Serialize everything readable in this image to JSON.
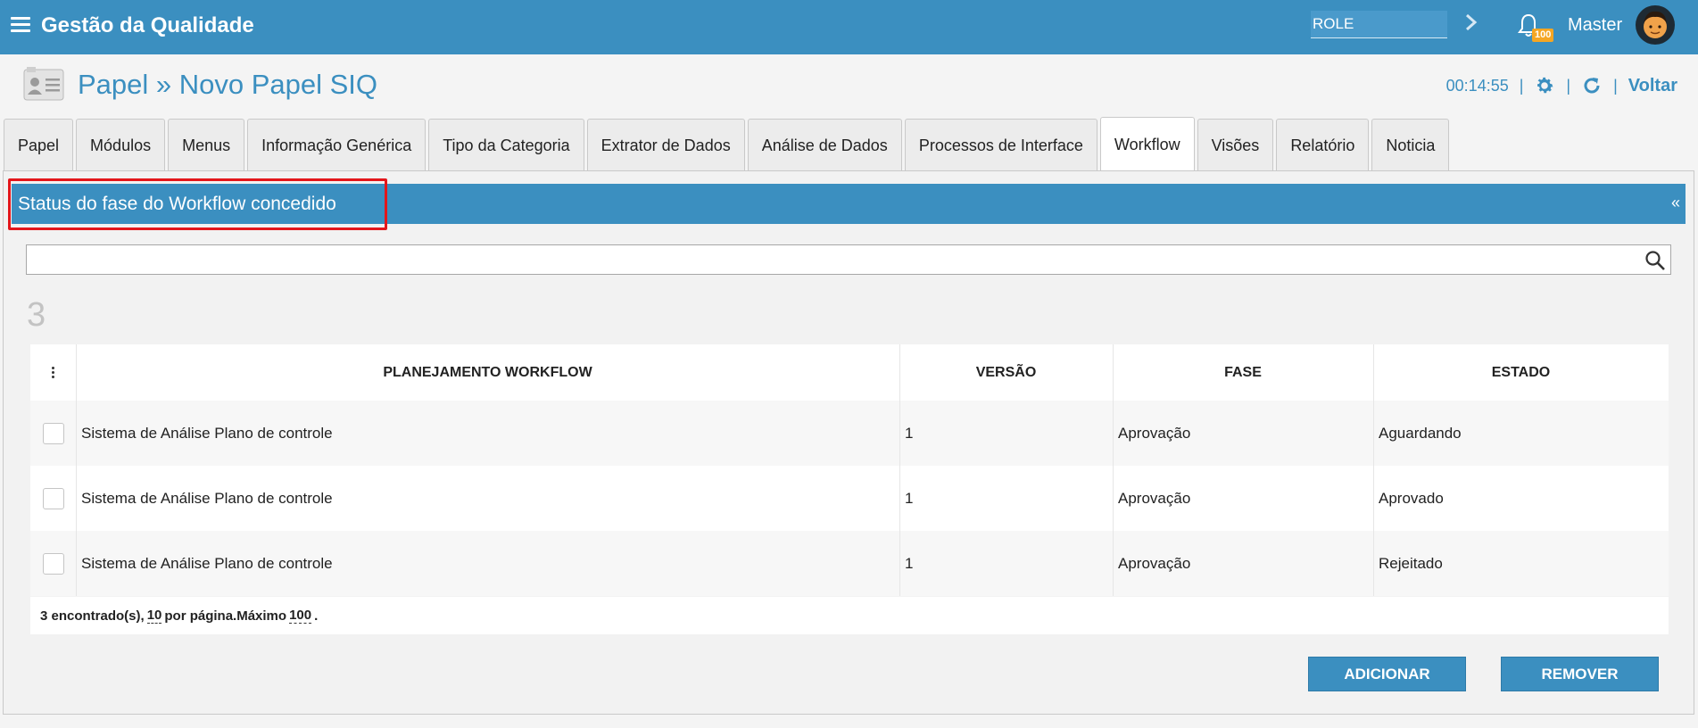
{
  "app": {
    "title": "Gestão da Qualidade"
  },
  "topbar": {
    "role_value": "ROLE",
    "notifications_badge": "100",
    "username": "Master"
  },
  "page": {
    "title": "Papel » Novo Papel SIQ",
    "timer": "00:14:55",
    "back_label": "Voltar"
  },
  "tabs": [
    {
      "label": "Papel"
    },
    {
      "label": "Módulos"
    },
    {
      "label": "Menus"
    },
    {
      "label": "Informação Genérica"
    },
    {
      "label": "Tipo da Categoria"
    },
    {
      "label": "Extrator de Dados"
    },
    {
      "label": "Análise de Dados"
    },
    {
      "label": "Processos de Interface"
    },
    {
      "label": "Workflow",
      "active": true
    },
    {
      "label": "Visões"
    },
    {
      "label": "Relatório"
    },
    {
      "label": "Noticia"
    }
  ],
  "section": {
    "title": "Status do fase do Workflow concedido",
    "collapse_glyph": "«"
  },
  "search": {
    "value": "",
    "placeholder": ""
  },
  "results_count": "3",
  "table": {
    "columns": [
      "PLANEJAMENTO WORKFLOW",
      "VERSÃO",
      "FASE",
      "ESTADO"
    ],
    "rows": [
      {
        "planejamento": "Sistema de Análise Plano de controle",
        "versao": "1",
        "fase": "Aprovação",
        "estado": "Aguardando"
      },
      {
        "planejamento": "Sistema de Análise Plano de controle",
        "versao": "1",
        "fase": "Aprovação",
        "estado": "Aprovado"
      },
      {
        "planejamento": "Sistema de Análise Plano de controle",
        "versao": "1",
        "fase": "Aprovação",
        "estado": "Rejeitado"
      }
    ],
    "footer": {
      "found_text": "3 encontrado(s),",
      "per_page_value": "10",
      "per_page_text": "por página.Máximo",
      "max_value": "100",
      "end": "."
    }
  },
  "actions": {
    "add_label": "ADICIONAR",
    "remove_label": "REMOVER"
  },
  "colors": {
    "primary": "#3b8fc0",
    "highlight": "#e3161b",
    "badge": "#f5a623"
  }
}
